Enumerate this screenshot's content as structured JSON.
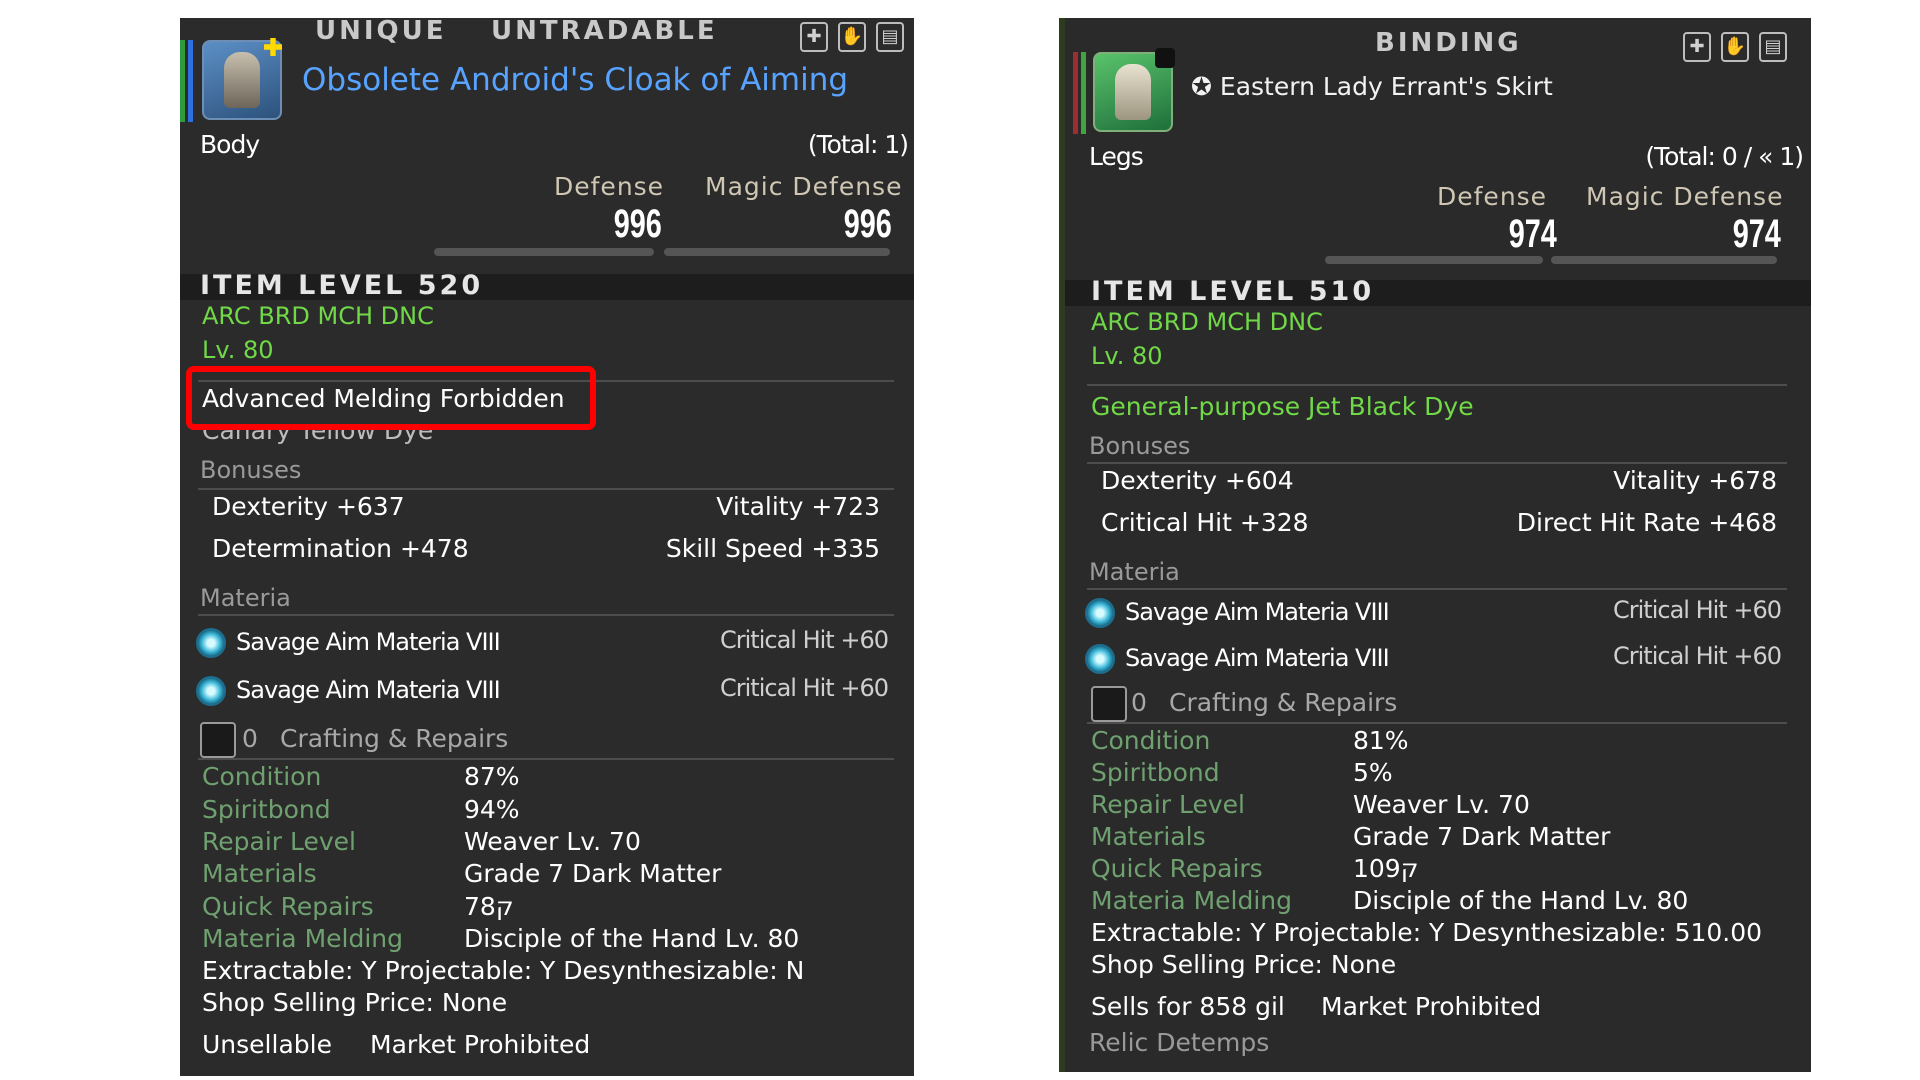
{
  "left": {
    "tags": [
      "UNIQUE",
      "UNTRADABLE"
    ],
    "item_name": "Obsolete Android's Cloak of Aiming",
    "slot": "Body",
    "total": "(Total: 1)",
    "defense_label": "Defense",
    "magic_defense_label": "Magic Defense",
    "defense": "996",
    "magic_defense": "996",
    "item_level": "ITEM LEVEL 520",
    "classes": "ARC BRD MCH DNC",
    "level": "Lv. 80",
    "melding_note": "Advanced Melding Forbidden",
    "dye_partial": "Canary Yellow Dye",
    "bonuses_label": "Bonuses",
    "bonuses": [
      {
        "left": "Dexterity +637",
        "right": "Vitality +723"
      },
      {
        "left": "Determination +478",
        "right": "Skill Speed +335"
      }
    ],
    "materia_label": "Materia",
    "materia": [
      {
        "name": "Savage Aim Materia VIII",
        "bonus": "Critical Hit +60"
      },
      {
        "name": "Savage Aim Materia VIII",
        "bonus": "Critical Hit +60"
      }
    ],
    "craft_count": "0",
    "craft_label": "Crafting & Repairs",
    "props": [
      {
        "label": "Condition",
        "value": "87%"
      },
      {
        "label": "Spiritbond",
        "value": "94%"
      },
      {
        "label": "Repair Level",
        "value": "Weaver Lv. 70"
      },
      {
        "label": "Materials",
        "value": "Grade 7 Dark Matter"
      },
      {
        "label": "Quick Repairs",
        "value": "78ק"
      },
      {
        "label": "Materia Melding",
        "value": "Disciple of the Hand Lv. 80"
      }
    ],
    "extract_line": "Extractable: Y  Projectable: Y  Desynthesizable: N",
    "shop_line": "Shop Selling Price: None",
    "sell_status": "Unsellable",
    "market_status": "Market Prohibited"
  },
  "right": {
    "tags": [
      "BINDING"
    ],
    "item_name": "Eastern Lady Errant's Skirt",
    "slot": "Legs",
    "total": "(Total: 0 / « 1)",
    "defense_label": "Defense",
    "magic_defense_label": "Magic Defense",
    "defense": "974",
    "magic_defense": "974",
    "item_level": "ITEM LEVEL 510",
    "classes": "ARC BRD MCH DNC",
    "level": "Lv. 80",
    "dye": "General-purpose Jet Black Dye",
    "bonuses_label": "Bonuses",
    "bonuses": [
      {
        "left": "Dexterity +604",
        "right": "Vitality +678"
      },
      {
        "left": "Critical Hit +328",
        "right": "Direct Hit Rate +468"
      }
    ],
    "materia_label": "Materia",
    "materia": [
      {
        "name": "Savage Aim Materia VIII",
        "bonus": "Critical Hit +60"
      },
      {
        "name": "Savage Aim Materia VIII",
        "bonus": "Critical Hit +60"
      }
    ],
    "craft_count": "0",
    "craft_label": "Crafting & Repairs",
    "props": [
      {
        "label": "Condition",
        "value": "81%"
      },
      {
        "label": "Spiritbond",
        "value": "5%"
      },
      {
        "label": "Repair Level",
        "value": "Weaver Lv. 70"
      },
      {
        "label": "Materials",
        "value": "Grade 7 Dark Matter"
      },
      {
        "label": "Quick Repairs",
        "value": "109ק"
      },
      {
        "label": "Materia Melding",
        "value": "Disciple of the Hand Lv. 80"
      }
    ],
    "extract_line": "Extractable: Y  Projectable: Y  Desynthesizable: 510.00",
    "shop_line": "Shop Selling Price: None",
    "sell_status": "Sells for 858 gil",
    "market_status": "Market Prohibited",
    "relic": "Relic Detemps"
  },
  "icons": [
    "add-icon",
    "hand-icon",
    "container-icon",
    "materia-icon",
    "crafting-icon"
  ],
  "colors": {
    "panel_bg": "#2b2b2b",
    "item_name": "#57a3ff",
    "class_green": "#71d947",
    "highlight": "#ff0000"
  }
}
